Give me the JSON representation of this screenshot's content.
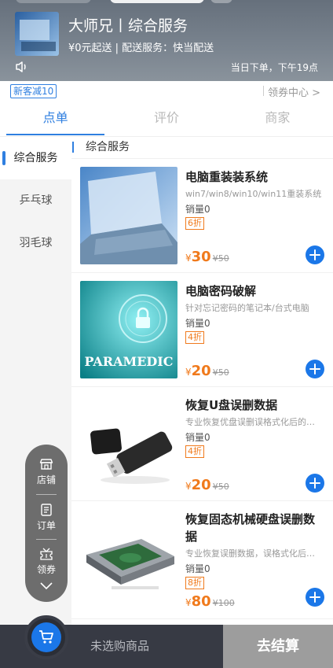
{
  "shop": {
    "name": "大师兄丨综合服务",
    "subtitle": "¥0元起送 | 配送服务：快当配送",
    "notice": "当日下单，下午19点"
  },
  "promo": {
    "badge": "新客减10",
    "coupon_center": "领券中心 >"
  },
  "tabs": [
    "点单",
    "评价",
    "商家"
  ],
  "categories": [
    "综合服务",
    "乒乓球",
    "羽毛球"
  ],
  "section_title": "综合服务",
  "products": [
    {
      "title": "电脑重装装系统",
      "desc": "win7/win8/win10/win11重装系统",
      "sales": "销量0",
      "discount": "6折",
      "price": "30",
      "original_price": "¥50"
    },
    {
      "title": "电脑密码破解",
      "desc": "针对忘记密码的笔记本/台式电脑",
      "sales": "销量0",
      "discount": "4折",
      "price": "20",
      "original_price": "¥50",
      "image_text": "PARAMEDIC"
    },
    {
      "title": "恢复U盘误删数据",
      "desc": "专业恢复优盘误删误格式化后的数据",
      "sales": "销量0",
      "discount": "4折",
      "price": "20",
      "original_price": "¥50"
    },
    {
      "title": "恢复固态机械硬盘误删数据",
      "desc": "专业恢复误删数据，误格式化后的数据",
      "sales": "销量0",
      "discount": "8折",
      "price": "80",
      "original_price": "¥100"
    }
  ],
  "currency": "¥",
  "float_menu": [
    "店铺",
    "订单",
    "领券"
  ],
  "bottom": {
    "empty_text": "未选购商品",
    "checkout": "去结算"
  },
  "colors": {
    "accent": "#1b77e8",
    "price": "#f07a1c",
    "bottom_bar": "#373a44",
    "checkout_bg": "#9d9d9d"
  },
  "icons": [
    "sound-icon",
    "chevron-right-icon",
    "plus-icon",
    "shop-icon",
    "order-icon",
    "coupon-icon",
    "chevron-down-icon",
    "cart-icon"
  ]
}
